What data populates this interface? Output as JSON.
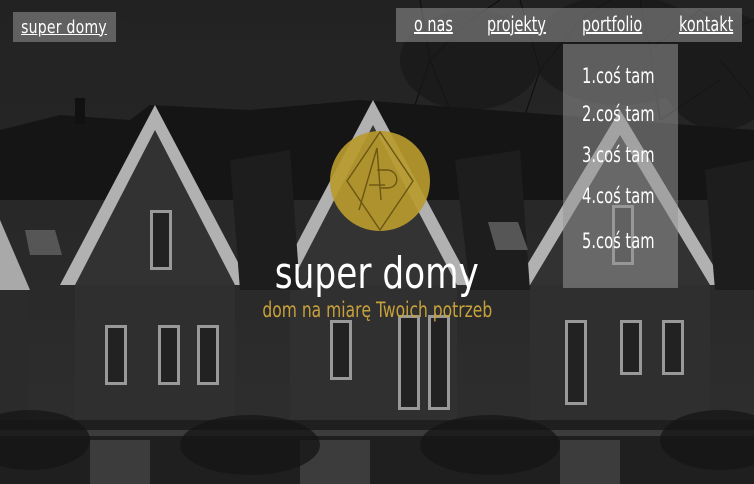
{
  "brand": {
    "label": "super domy"
  },
  "nav": {
    "items": [
      {
        "label": "o nas"
      },
      {
        "label": "projekty"
      },
      {
        "label": "portfolio"
      },
      {
        "label": "kontakt"
      }
    ]
  },
  "dropdown": {
    "items": [
      {
        "label": "1.coś tam"
      },
      {
        "label": "2.coś tam"
      },
      {
        "label": "3.coś tam"
      },
      {
        "label": "4.coś tam"
      },
      {
        "label": "5.coś tam"
      }
    ]
  },
  "hero": {
    "title": "super domy",
    "subtitle": "dom na miarę Twoich potrzeb",
    "logo_icon": "ap-monogram-logo-icon"
  },
  "colors": {
    "accent": "#c7a13a",
    "overlay": "#969696",
    "text": "#ffffff"
  }
}
